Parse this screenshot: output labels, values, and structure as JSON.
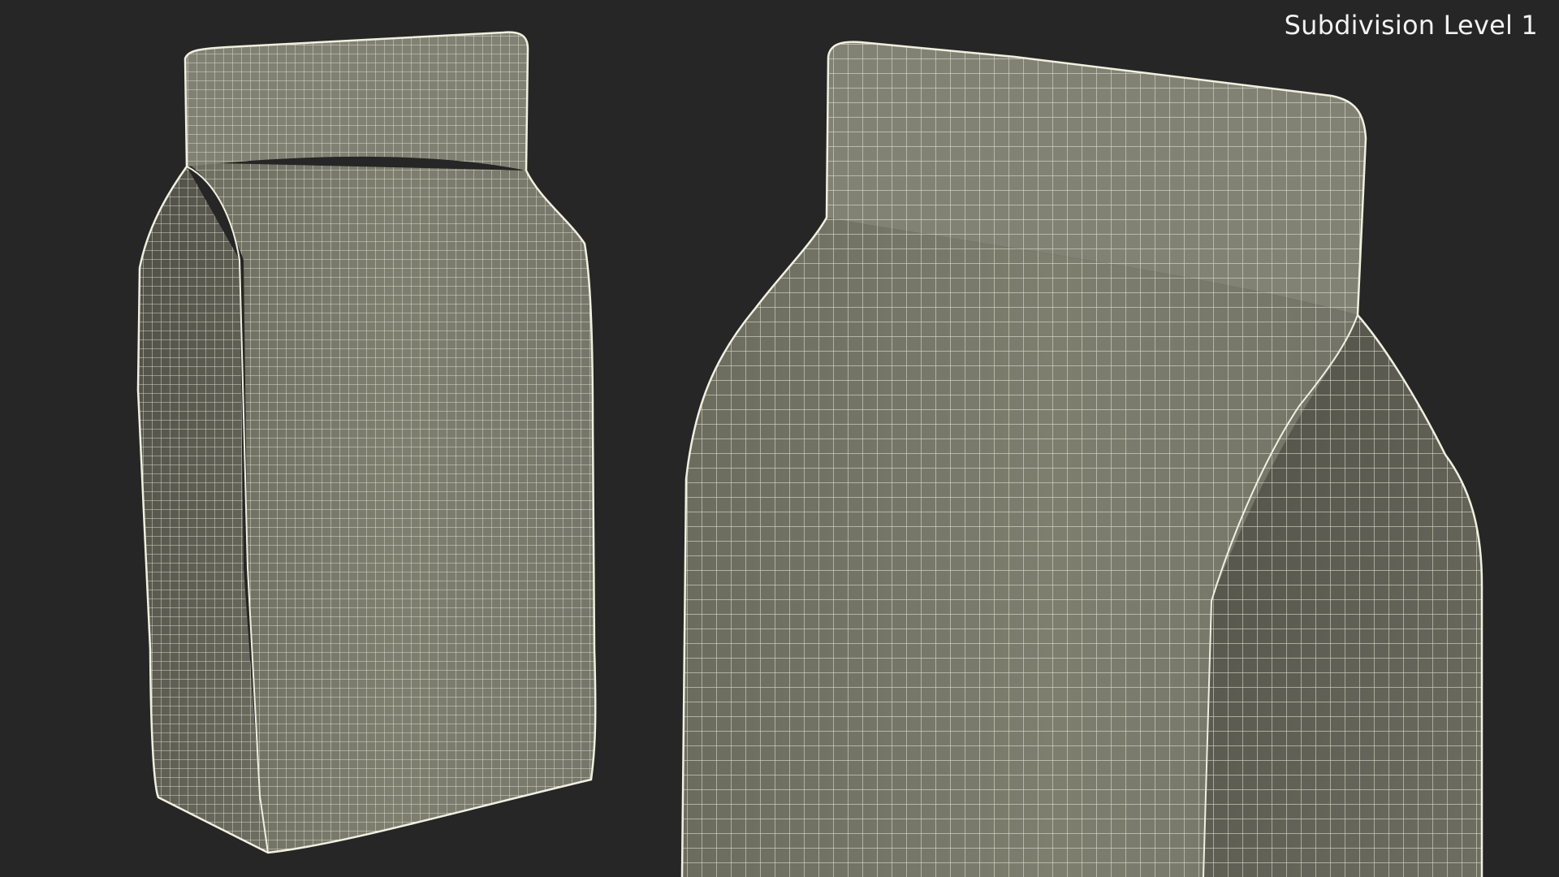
{
  "overlay": {
    "label": "Subdivision Level 1"
  },
  "colors": {
    "background": "#262626",
    "surface_front": "#7b7b6c",
    "surface_side": "#5f5f54",
    "wire": "#e9e9d8"
  }
}
